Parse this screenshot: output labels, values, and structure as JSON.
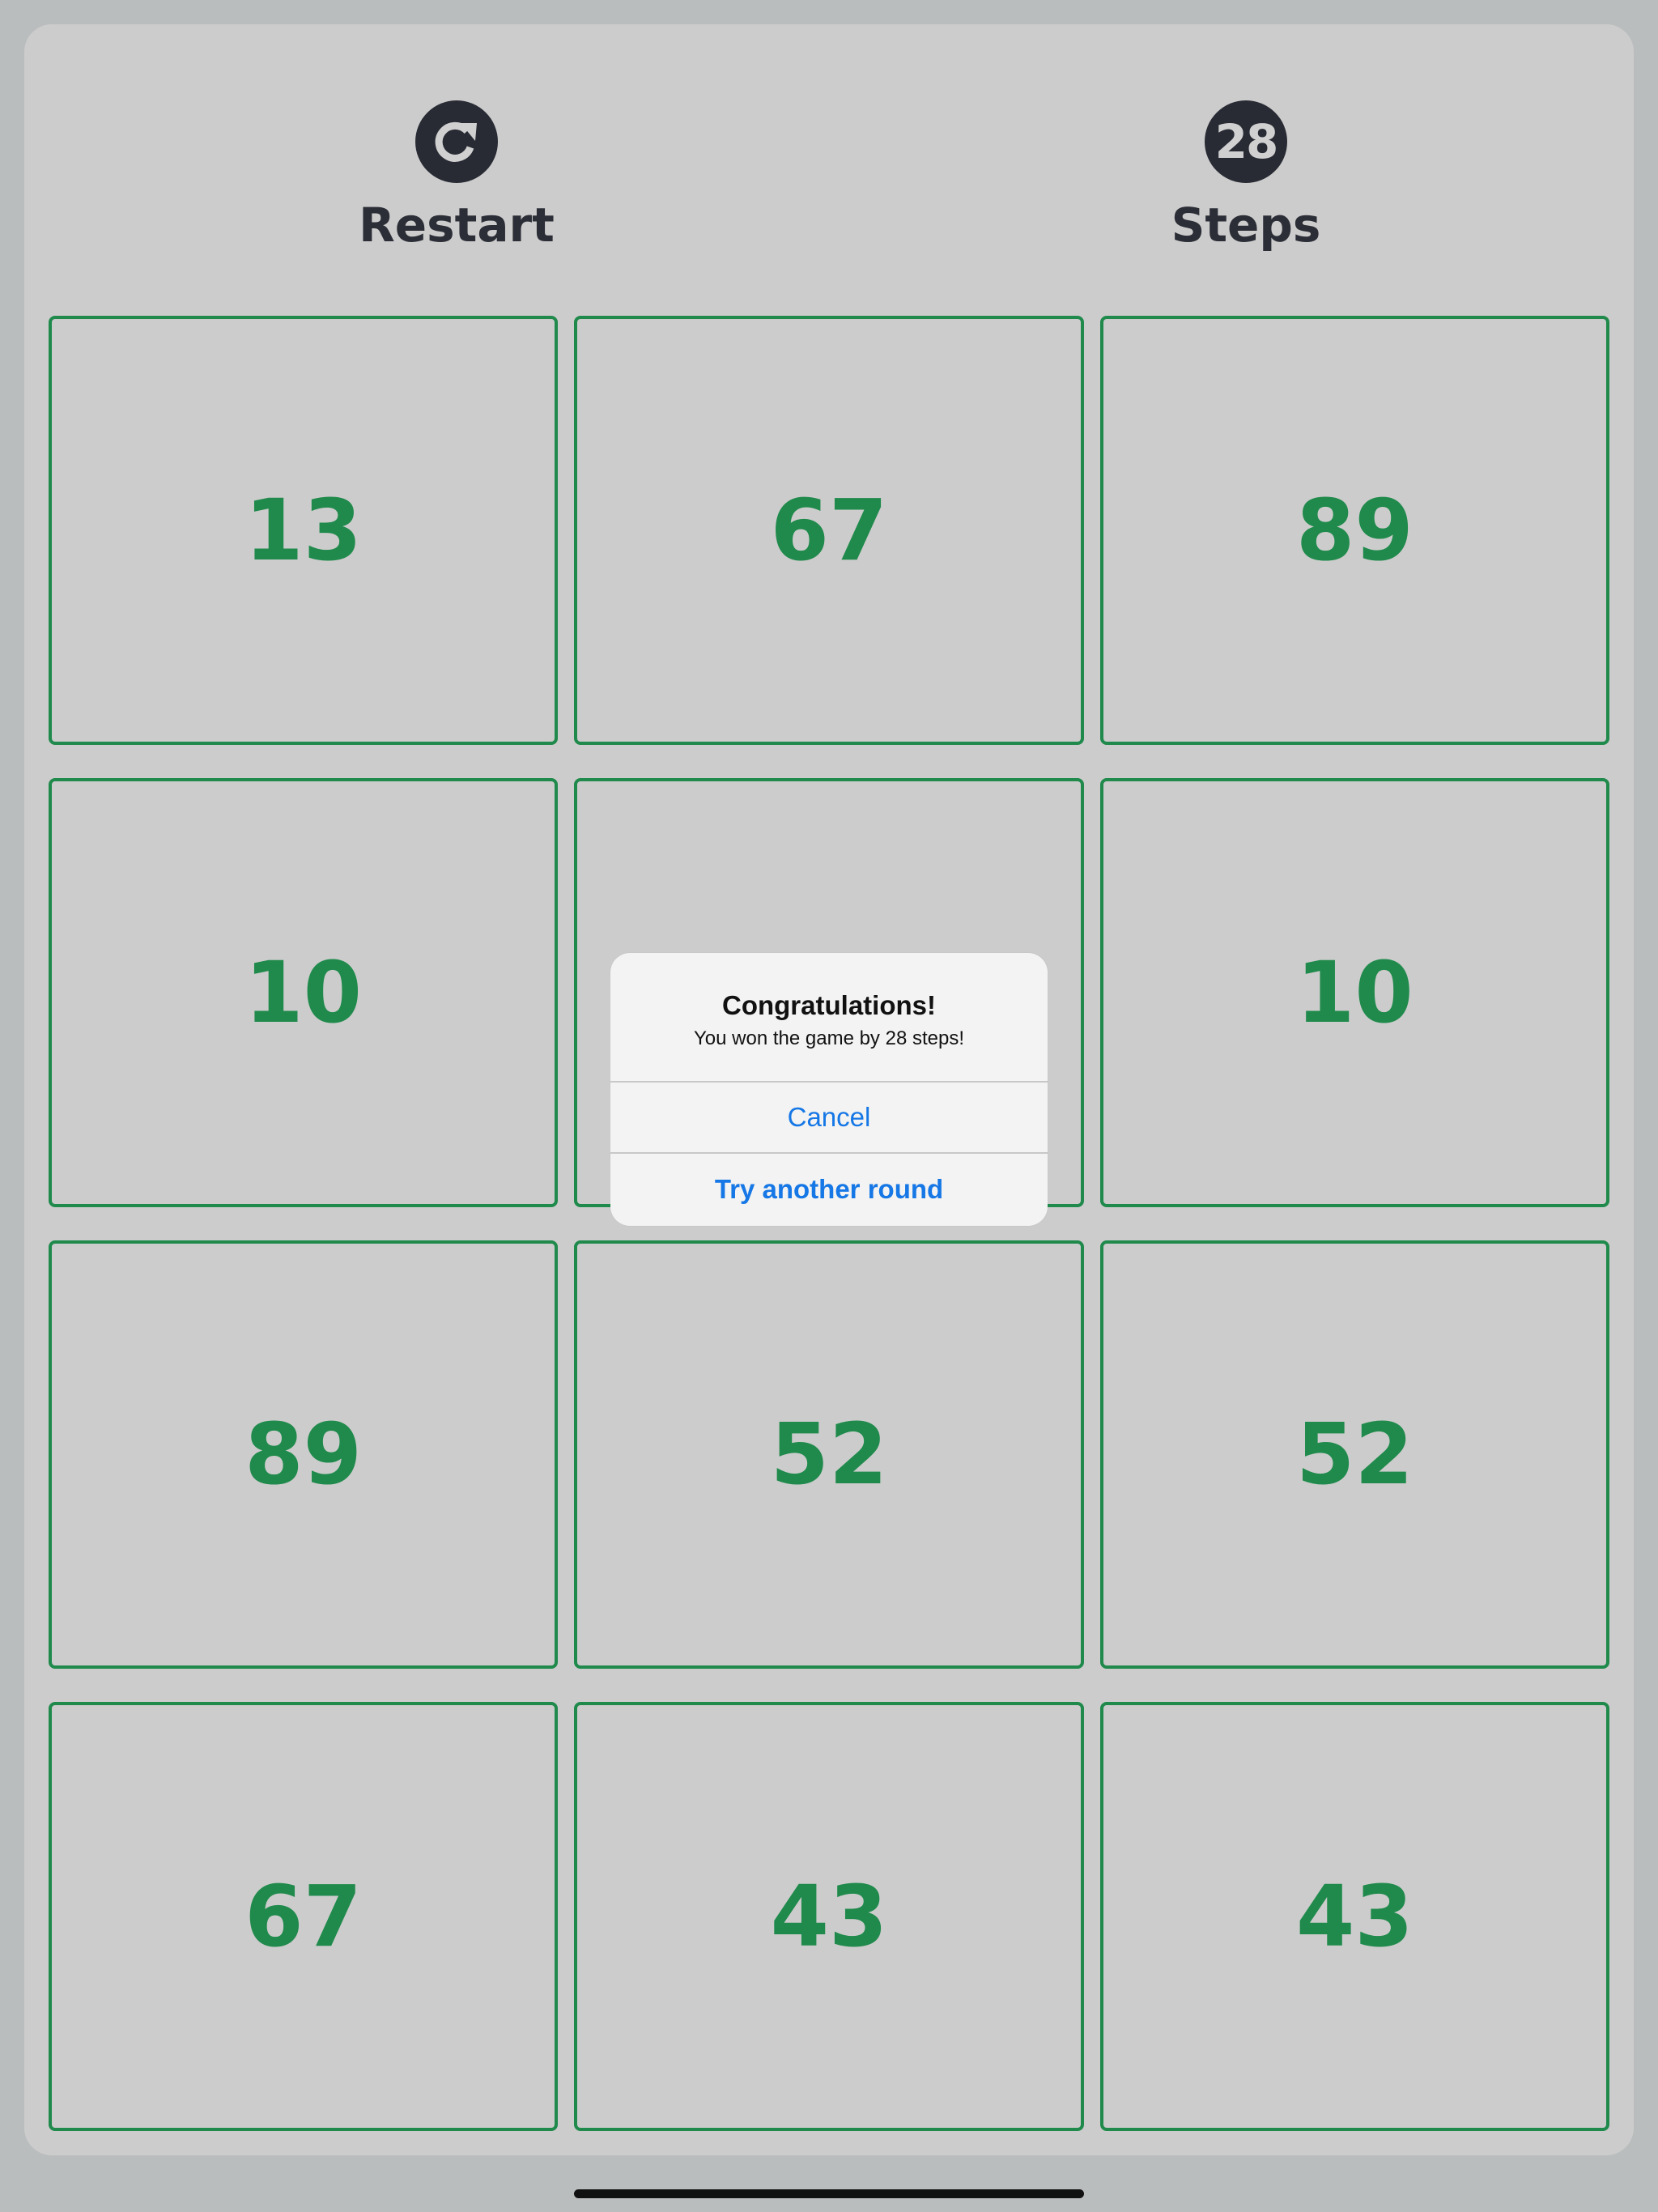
{
  "header": {
    "restart": {
      "icon": "restart-icon",
      "label": "Restart"
    },
    "steps": {
      "count": "28",
      "label": "Steps"
    }
  },
  "cards": [
    {
      "value": "13"
    },
    {
      "value": "67"
    },
    {
      "value": "89"
    },
    {
      "value": "10"
    },
    {
      "value": ""
    },
    {
      "value": "10"
    },
    {
      "value": "89"
    },
    {
      "value": "52"
    },
    {
      "value": "52"
    },
    {
      "value": "67"
    },
    {
      "value": "43"
    },
    {
      "value": "43"
    }
  ],
  "dialog": {
    "title": "Congratulations!",
    "message": "You won the game by 28 steps!",
    "cancel_label": "Cancel",
    "primary_label": "Try another round"
  },
  "colors": {
    "card_accent": "#1f8a4b",
    "header_dark": "#282b34",
    "button_blue": "#1677e6"
  }
}
